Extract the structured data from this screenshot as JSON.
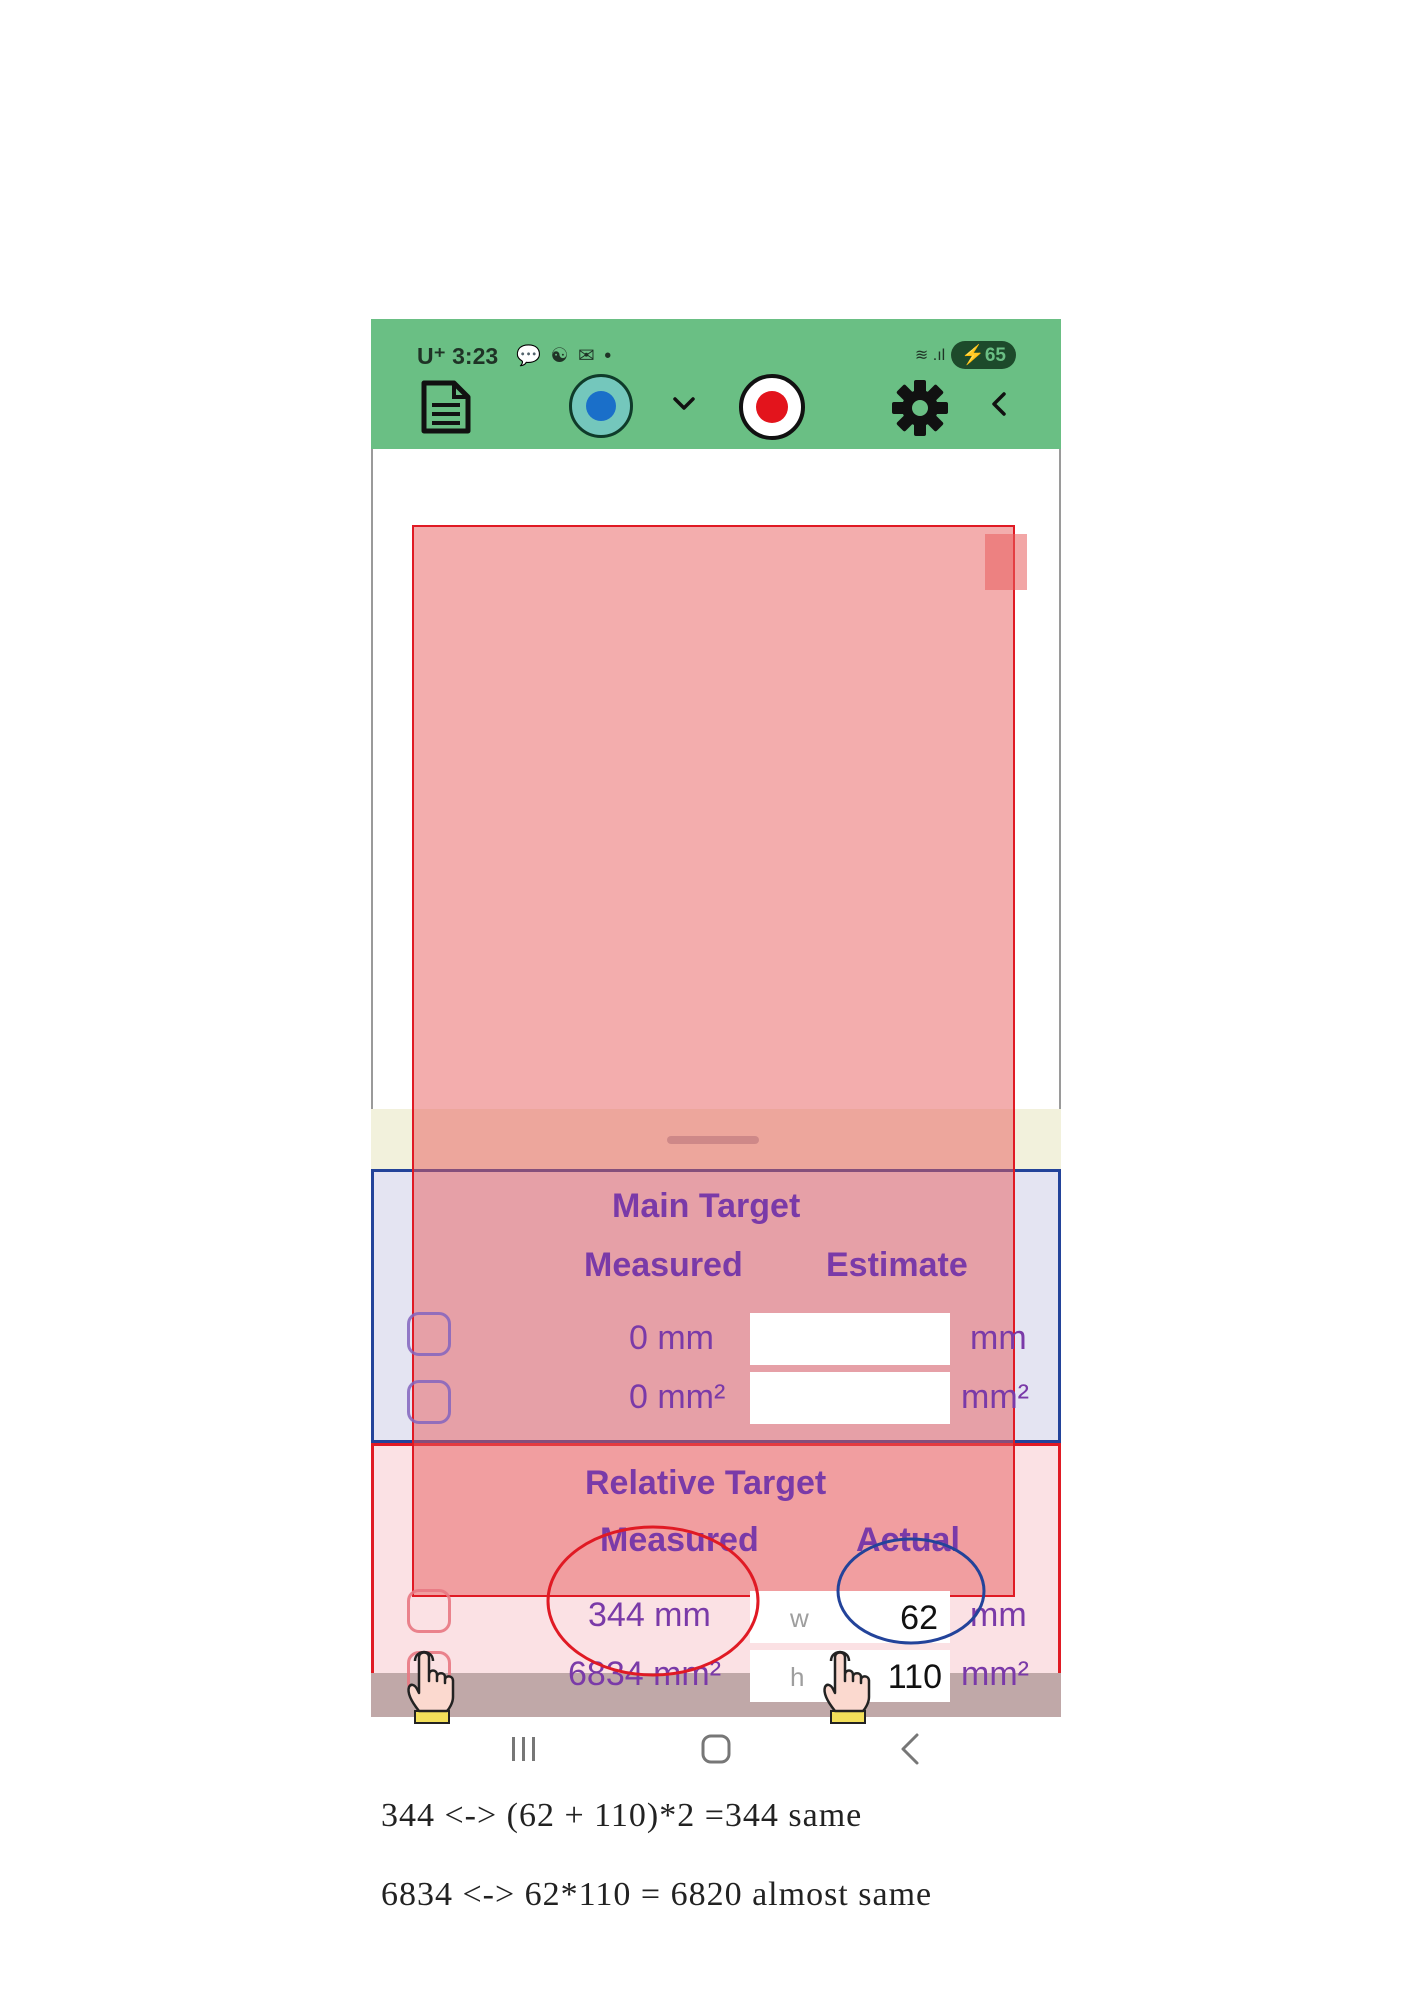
{
  "status_bar": {
    "carrier_time": "U⁺ 3:23",
    "notification_icons": "💬 ☯ ✉ •",
    "signal": "≋ .ıl",
    "battery": "⚡65"
  },
  "toolbar": {
    "doc_icon": "document-icon",
    "radio_icon": "radio-button-icon",
    "dropdown_icon": "chevron-down-icon",
    "record_icon": "record-icon",
    "settings_icon": "gear-icon",
    "back_icon": "chevron-left-icon"
  },
  "main_target": {
    "title": "Main Target",
    "col_measured": "Measured",
    "col_estimate": "Estimate",
    "rows": [
      {
        "measured": "0  mm",
        "estimate_value": "",
        "unit": "mm"
      },
      {
        "measured": "0  mm²",
        "estimate_value": "",
        "unit": "mm²"
      }
    ]
  },
  "relative_target": {
    "title": "Relative Target",
    "col_measured": "Measured",
    "col_actual": "Actual",
    "rows": [
      {
        "measured": "344  mm",
        "placeholder": "w",
        "actual_value": "62",
        "unit": "mm"
      },
      {
        "measured": "6834 mm²",
        "placeholder": "h",
        "actual_value": "110",
        "unit": "mm²"
      }
    ]
  },
  "nav_bar": {
    "recents_icon": "recents-icon",
    "home_icon": "home-icon",
    "back_icon": "back-icon"
  },
  "annotations": {
    "line1": "344   <->  (62 + 110)*2 =344    same",
    "line2": "6834 <->  62*110  = 6820   almost same"
  },
  "colors": {
    "toolbar_bg": "#6abf84",
    "target_fill": "#e85c5c",
    "main_border": "#23439a",
    "relative_border": "#e01a24",
    "label_text": "#7a3aa8"
  }
}
